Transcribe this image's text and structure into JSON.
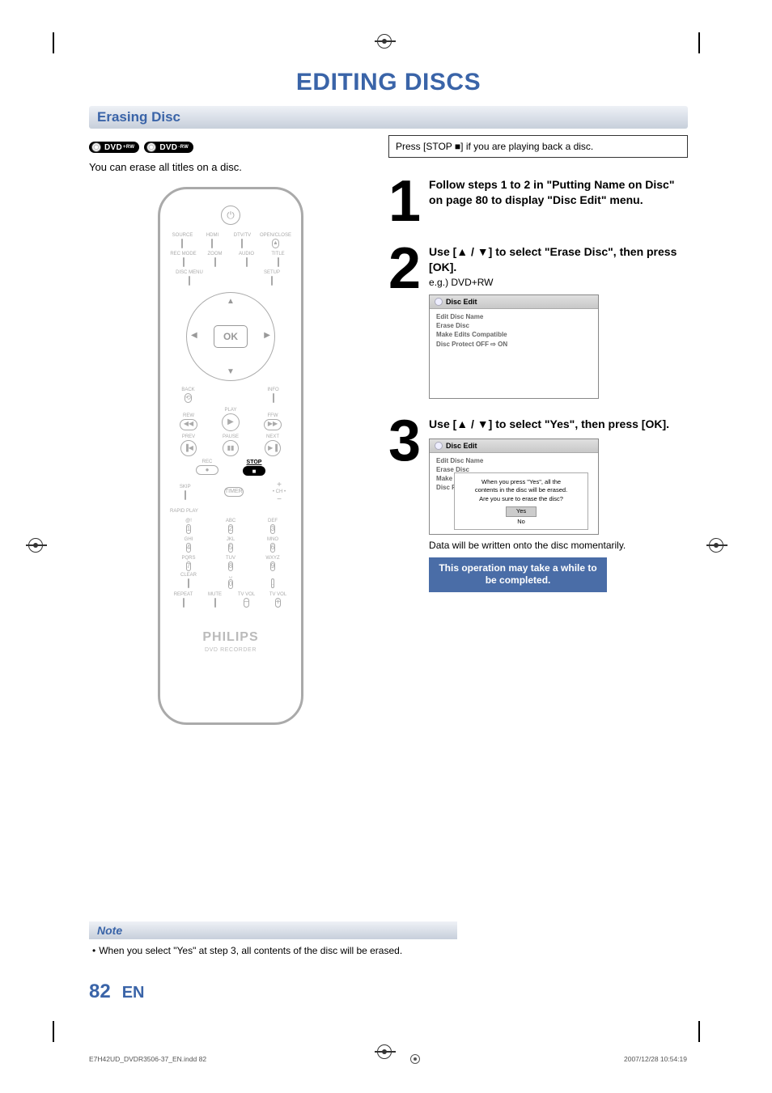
{
  "page_title": "EDITING DISCS",
  "section_title": "Erasing Disc",
  "badges": [
    "DVD+RW",
    "DVD-RW"
  ],
  "intro": "You can erase all titles on a disc.",
  "press_box": "Press [STOP ■] if you are playing back a disc.",
  "steps": {
    "1": {
      "text": "Follow steps 1 to 2 in \"Putting Name on Disc\" on page 80 to display \"Disc Edit\" menu."
    },
    "2": {
      "text": "Use [▲ / ▼] to select \"Erase Disc\", then press [OK].",
      "sub": "e.g.) DVD+RW",
      "menu": {
        "title": "Disc Edit",
        "items": [
          "Edit Disc Name",
          "Erase Disc",
          "Make Edits Compatible",
          "Disc Protect OFF ⇨ ON"
        ]
      }
    },
    "3": {
      "text": "Use [▲ / ▼] to select \"Yes\", then press [OK].",
      "menu": {
        "title": "Disc Edit",
        "items": [
          "Edit Disc Name",
          "Erase Disc",
          "Make",
          "Disc P"
        ],
        "popup": {
          "lines": [
            "When you press \"Yes\", all the",
            "contents in the disc will be erased.",
            "Are you sure to erase the disc?"
          ],
          "options": [
            "Yes",
            "No"
          ],
          "selected": 0
        }
      },
      "result": "Data will be written onto the disc momentarily.",
      "blue_note": "This operation may take a while to be completed."
    }
  },
  "remote": {
    "row1": [
      "SOURCE",
      "HDMI",
      "DTV/TV",
      "OPEN/CLOSE"
    ],
    "row2": [
      "REC MODE",
      "ZOOM",
      "AUDIO",
      "TITLE"
    ],
    "row3_left": "DISC MENU",
    "row3_right": "SETUP",
    "ok": "OK",
    "back": "BACK",
    "info": "INFO",
    "play": "PLAY",
    "rew": "REW",
    "ffw": "FFW",
    "prev": "PREV",
    "pause": "PAUSE",
    "next": "NEXT",
    "rec": "REC",
    "stop": "STOP",
    "skip": "SKIP",
    "timer": "TIMER",
    "ch": "CH",
    "rapid": "RAPID PLAY",
    "num_labels": [
      "@!",
      "ABC",
      "DEF",
      "GHI",
      "JKL",
      "MNO",
      "PQRS",
      "TUV",
      "WXYZ"
    ],
    "nums": [
      "1",
      "2",
      "3",
      "4",
      "5",
      "6",
      "7",
      "8",
      "9",
      "0"
    ],
    "bottom": [
      "CLEAR",
      "",
      "",
      "."
    ],
    "bottom2": [
      "REPEAT",
      "MUTE",
      "TV VOL",
      "TV VOL"
    ],
    "brand": "PHILIPS",
    "brand_sub": "DVD RECORDER"
  },
  "note": {
    "heading": "Note",
    "body": "When you select \"Yes\" at step 3, all contents of the disc will be erased."
  },
  "page_number": "82",
  "page_lang": "EN",
  "print_footer_file": "E7H42UD_DVDR3506-37_EN.indd   82",
  "print_footer_date": "2007/12/28   10:54:19"
}
